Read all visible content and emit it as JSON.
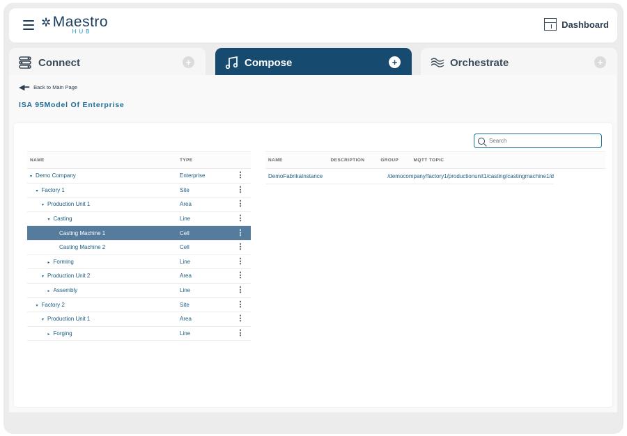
{
  "header": {
    "logo_text": "Maestro",
    "logo_sub": "HUB",
    "dashboard_label": "Dashboard"
  },
  "tabs": [
    {
      "label": "Connect",
      "icon": "connect-icon",
      "active": false
    },
    {
      "label": "Compose",
      "icon": "music-note-icon",
      "active": true
    },
    {
      "label": "Orchestrate",
      "icon": "waves-icon",
      "active": false
    }
  ],
  "page": {
    "back_label": "Back to Main Page",
    "title": "ISA 95Model Of Enterprise"
  },
  "search": {
    "placeholder": "Search"
  },
  "tree": {
    "columns": [
      "NAME",
      "TYPE"
    ],
    "rows": [
      {
        "name": "Demo Company",
        "type": "Enterprise",
        "level": 0,
        "caret": "▾",
        "selected": false
      },
      {
        "name": "Factory 1",
        "type": "Site",
        "level": 1,
        "caret": "▾",
        "selected": false
      },
      {
        "name": "Production Unit 1",
        "type": "Area",
        "level": 2,
        "caret": "▾",
        "selected": false
      },
      {
        "name": "Casting",
        "type": "Line",
        "level": 3,
        "caret": "▾",
        "selected": false
      },
      {
        "name": "Casting Machine 1",
        "type": "Cell",
        "level": 4,
        "caret": "",
        "selected": true
      },
      {
        "name": "Casting Machine 2",
        "type": "Cell",
        "level": 4,
        "caret": "",
        "selected": false
      },
      {
        "name": "Forming",
        "type": "Line",
        "level": 3,
        "caret": "▸",
        "selected": false
      },
      {
        "name": "Production Unit 2",
        "type": "Area",
        "level": 2,
        "caret": "▾",
        "selected": false
      },
      {
        "name": "Assembly",
        "type": "Line",
        "level": 3,
        "caret": "▸",
        "selected": false
      },
      {
        "name": "Factory 2",
        "type": "Site",
        "level": 1,
        "caret": "▾",
        "selected": false
      },
      {
        "name": "Production Unit 1",
        "type": "Area",
        "level": 2,
        "caret": "▾",
        "selected": false
      },
      {
        "name": "Forging",
        "type": "Line",
        "level": 3,
        "caret": "▸",
        "selected": false
      }
    ]
  },
  "detail": {
    "columns": [
      "NAME",
      "DESCRIPTION",
      "GROUP",
      "MQTT TOPIC"
    ],
    "rows": [
      {
        "name": "DemoFabrikaInstance",
        "description": "",
        "group": "",
        "mqtt_topic": "/democompany/factory1/productionunit1/casting/castingmachine1/d"
      }
    ]
  },
  "colors": {
    "accent": "#164a6e",
    "selected_row": "#557c9c",
    "link": "#1b5c80"
  }
}
